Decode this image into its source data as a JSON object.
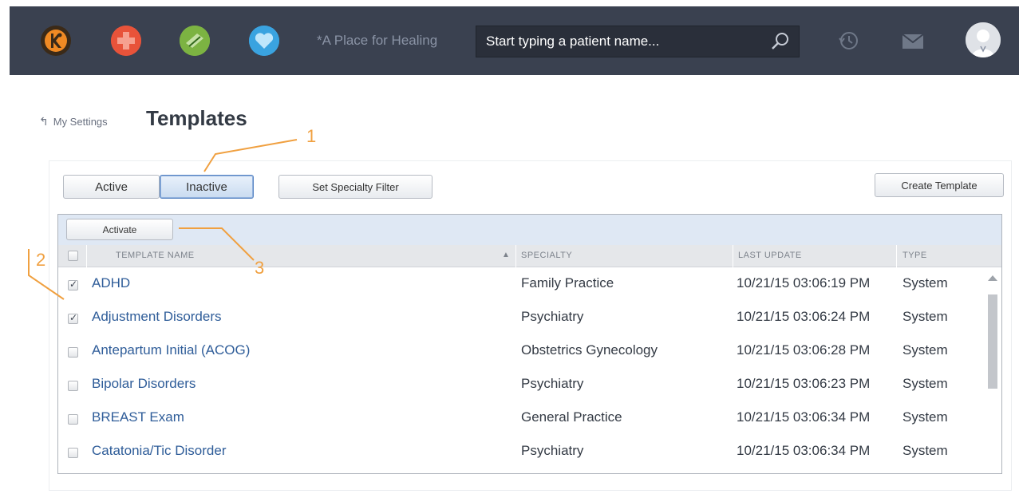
{
  "header": {
    "clinic_name": "*A Place for Healing",
    "search_placeholder": "Start typing a patient name...",
    "brand_colors": {
      "bar": "#3a4150",
      "orange": "#f08a24",
      "red": "#e8533a",
      "green": "#8bc34a",
      "blue": "#3aa3e0"
    }
  },
  "breadcrumb": {
    "back_label": "My Settings"
  },
  "page": {
    "title": "Templates"
  },
  "toolbar": {
    "tabs": [
      {
        "label": "Active",
        "selected": false
      },
      {
        "label": "Inactive",
        "selected": true
      }
    ],
    "specialty_filter_label": "Set Specialty Filter",
    "create_label": "Create Template"
  },
  "grid": {
    "activate_label": "Activate",
    "columns": [
      "TEMPLATE NAME",
      "SPECIALTY",
      "LAST UPDATE",
      "TYPE"
    ],
    "sort_indicator": "▲",
    "rows": [
      {
        "checked": true,
        "name": "ADHD",
        "specialty": "Family Practice",
        "updated": "10/21/15 03:06:19 PM",
        "type": "System"
      },
      {
        "checked": true,
        "name": "Adjustment Disorders",
        "specialty": "Psychiatry",
        "updated": "10/21/15 03:06:24 PM",
        "type": "System"
      },
      {
        "checked": false,
        "name": "Antepartum Initial (ACOG)",
        "specialty": "Obstetrics Gynecology",
        "updated": "10/21/15 03:06:28 PM",
        "type": "System"
      },
      {
        "checked": false,
        "name": "Bipolar Disorders",
        "specialty": "Psychiatry",
        "updated": "10/21/15 03:06:23 PM",
        "type": "System"
      },
      {
        "checked": false,
        "name": "BREAST Exam",
        "specialty": "General Practice",
        "updated": "10/21/15 03:06:34 PM",
        "type": "System"
      },
      {
        "checked": false,
        "name": "Catatonia/Tic Disorder",
        "specialty": "Psychiatry",
        "updated": "10/21/15 03:06:34 PM",
        "type": "System"
      }
    ]
  },
  "callouts": {
    "one": "1",
    "two": "2",
    "three": "3",
    "color": "#f0a040"
  }
}
